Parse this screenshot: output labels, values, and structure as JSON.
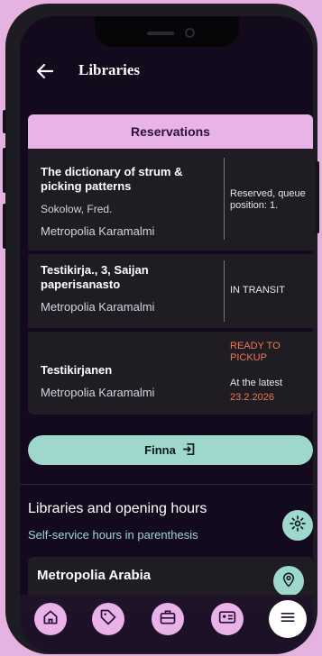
{
  "app_bar": {
    "title": "Libraries"
  },
  "reservations": {
    "header": "Reservations",
    "items": [
      {
        "title": "The dictionary of strum & picking patterns",
        "author": "Sokolow, Fred.",
        "location": "Metropolia Karamalmi",
        "status": "Reserved, queue position: 1."
      },
      {
        "title": "Testikirja., 3, Saijan paperisanasto",
        "location": "Metropolia Karamalmi",
        "status": "IN TRANSIT"
      },
      {
        "title": "Testikirjanen",
        "location": "Metropolia Karamalmi",
        "status": "READY TO PICKUP",
        "deadline_label": "At the latest",
        "deadline_date": "23.2.2026"
      }
    ]
  },
  "finna_button": {
    "label": "Finna"
  },
  "libraries_section": {
    "title": "Libraries and opening hours",
    "subtitle": "Self-service hours in parenthesis"
  },
  "library_list": [
    {
      "name": "Metropolia Arabia"
    }
  ],
  "colors": {
    "accent_pink": "#e9b3e9",
    "accent_teal": "#9ed8cc",
    "ready_orange": "#f07a55",
    "background": "#130a1e"
  },
  "bottom_nav": [
    {
      "icon": "home-icon"
    },
    {
      "icon": "tag-icon"
    },
    {
      "icon": "briefcase-icon"
    },
    {
      "icon": "id-card-icon"
    },
    {
      "icon": "menu-icon",
      "active": true
    }
  ]
}
